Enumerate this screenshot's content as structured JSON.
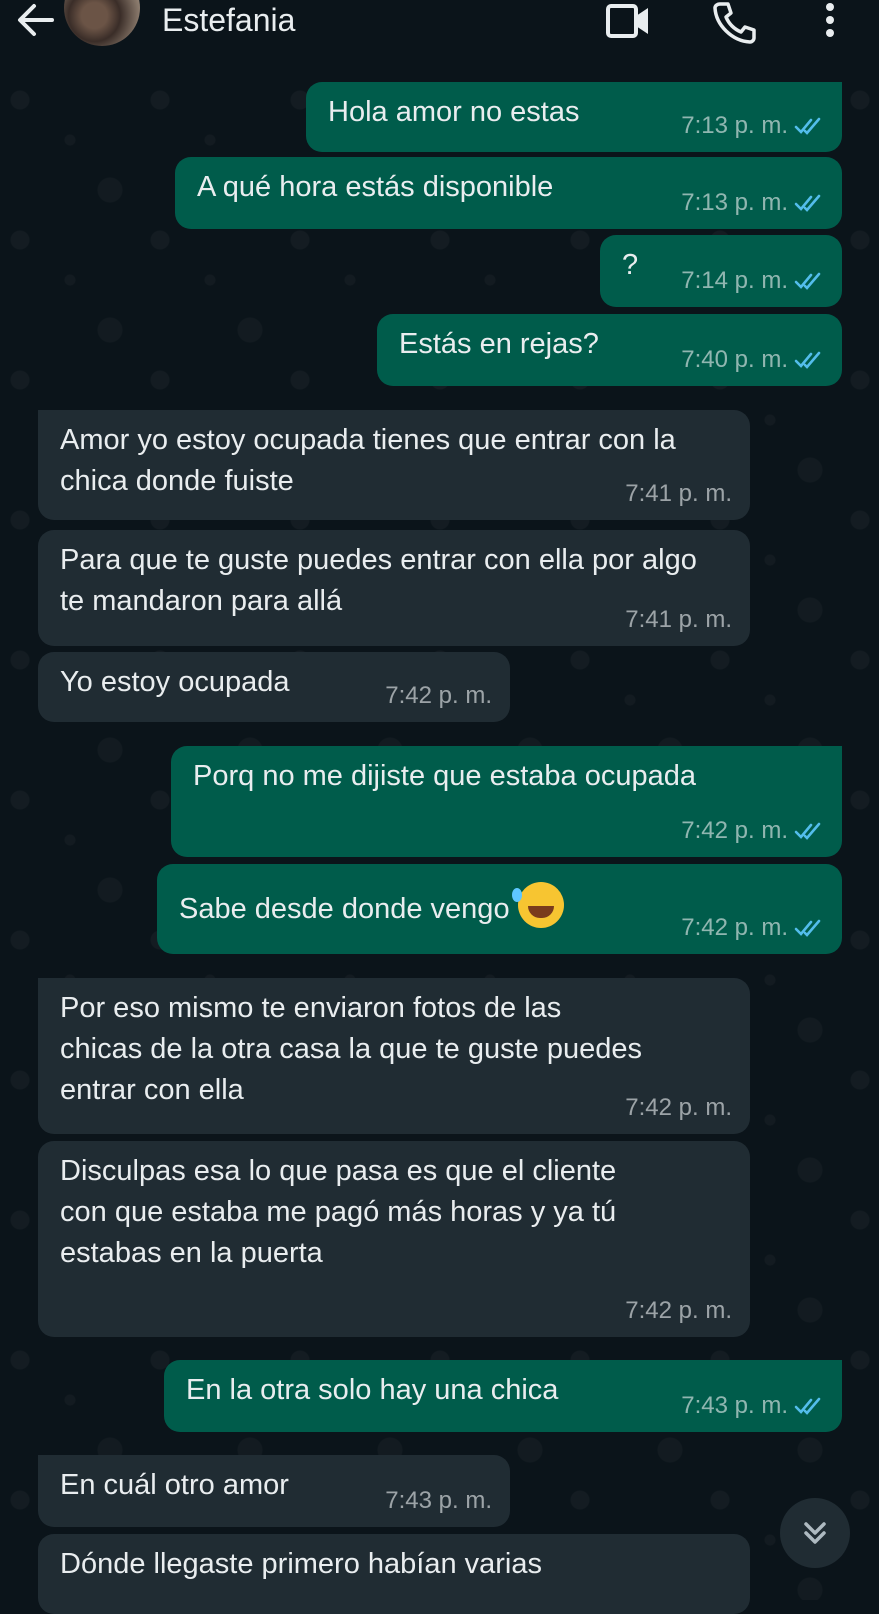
{
  "header": {
    "title": "Estefania",
    "back_icon": "arrow-left-icon",
    "video_icon": "video-camera-icon",
    "call_icon": "phone-icon",
    "menu_icon": "more-vertical-icon"
  },
  "colors": {
    "background": "#0b141a",
    "outgoing_bubble": "#005c4b",
    "incoming_bubble": "#202c33",
    "read_ticks": "#53bdeb"
  },
  "messages": [
    {
      "dir": "out",
      "text": "Hola amor no estas",
      "time": "7:13 p. m.",
      "read": true
    },
    {
      "dir": "out",
      "text": "A qué hora estás disponible",
      "time": "7:13 p. m.",
      "read": true
    },
    {
      "dir": "out",
      "text": "?",
      "time": "7:14 p. m.",
      "read": true
    },
    {
      "dir": "out",
      "text": "Estás en rejas?",
      "time": "7:40 p. m.",
      "read": true
    },
    {
      "dir": "in",
      "text": "Amor yo estoy ocupada tienes que entrar con la chica donde fuiste",
      "time": "7:41 p. m."
    },
    {
      "dir": "in",
      "text": "Para que te guste puedes entrar con ella por algo te mandaron para allá",
      "time": "7:41 p. m."
    },
    {
      "dir": "in",
      "text": "Yo estoy ocupada",
      "time": "7:42 p. m."
    },
    {
      "dir": "out",
      "text": "Porq no me dijiste que estaba ocupada",
      "time": "7:42 p. m.",
      "read": true
    },
    {
      "dir": "out",
      "text": "Sabe desde donde vengo",
      "emoji": "rolling-on-floor-laughing-emoji",
      "time": "7:42 p. m.",
      "read": true
    },
    {
      "dir": "in",
      "text": "Por eso mismo te enviaron fotos de las chicas de la otra casa la que te guste puedes entrar con ella",
      "time": "7:42 p. m."
    },
    {
      "dir": "in",
      "text": "Disculpas esa lo que pasa es que el cliente con que estaba me pagó más horas y ya tú estabas en la puerta",
      "time": "7:42 p. m."
    },
    {
      "dir": "out",
      "text": "En la otra solo hay una chica",
      "time": "7:43 p. m.",
      "read": true
    },
    {
      "dir": "in",
      "text": "En cuál otro amor",
      "time": "7:43 p. m."
    },
    {
      "dir": "in",
      "text": "Dónde llegaste primero habían varias",
      "time": ""
    }
  ],
  "scroll_button_icon": "chevrons-down-icon"
}
